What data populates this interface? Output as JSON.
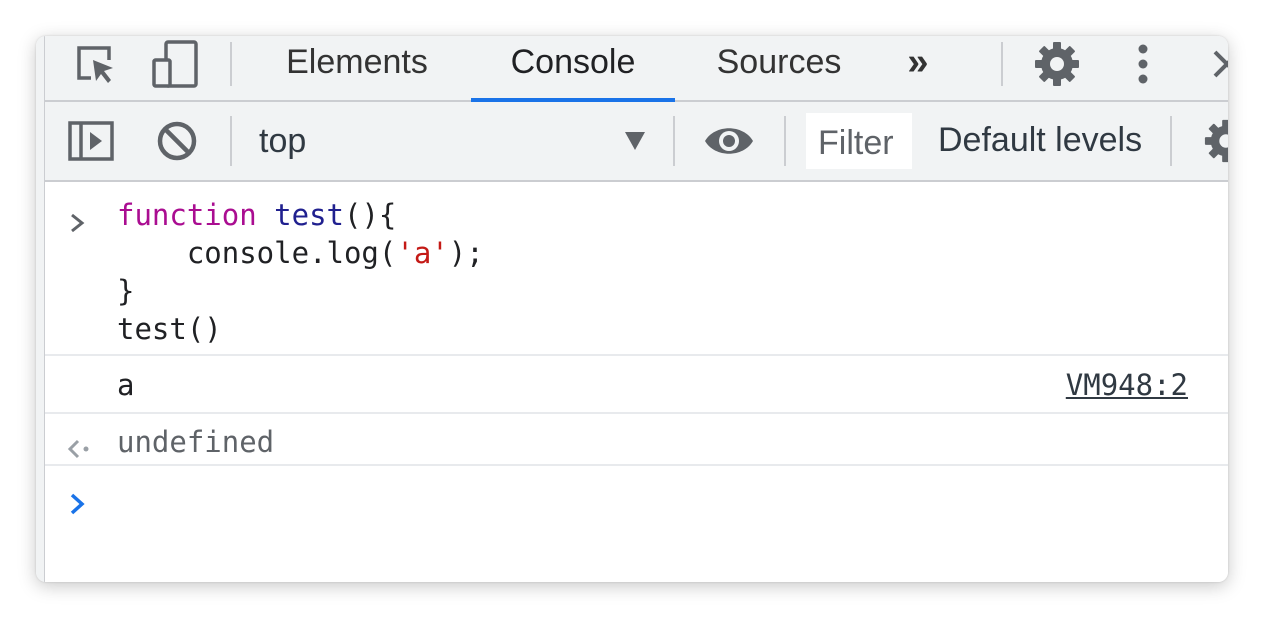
{
  "tabs": {
    "items": [
      {
        "label": "Elements",
        "active": false
      },
      {
        "label": "Console",
        "active": true
      },
      {
        "label": "Sources",
        "active": false
      }
    ],
    "more_label": "»"
  },
  "toolbar": {
    "context": "top",
    "filter_placeholder": "Filter",
    "levels": "Default levels"
  },
  "console": {
    "input": {
      "l1_kw": "function",
      "l1_fn": "test",
      "l1_rest": "(){",
      "l2_pre": "    console.log(",
      "l2_str": "'a'",
      "l2_post": ");",
      "l3": "}",
      "l4": "test()"
    },
    "log": {
      "text": "a",
      "source": "VM948:2"
    },
    "result": {
      "text": "undefined"
    }
  },
  "colors": {
    "accent": "#1a73e8",
    "keyword": "#aa0d91",
    "string": "#c41a16",
    "toolbar_bg": "#f1f3f4"
  }
}
